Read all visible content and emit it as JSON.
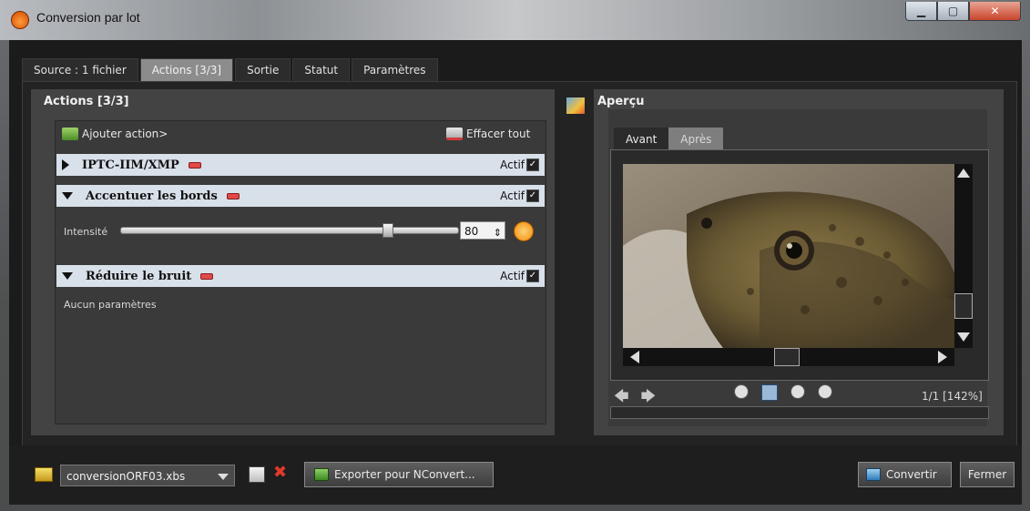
{
  "window": {
    "title": "Conversion par lot"
  },
  "tabs": [
    {
      "label": "Source : 1 fichier"
    },
    {
      "label": "Actions [3/3]"
    },
    {
      "label": "Sortie"
    },
    {
      "label": "Statut"
    },
    {
      "label": "Paramètres"
    }
  ],
  "actions_panel": {
    "title": "Actions [3/3]",
    "add_label": "Ajouter action>",
    "clear_label": "Effacer tout",
    "items": [
      {
        "name": "IPTC-IIM/XMP",
        "status": "Actif",
        "expanded": false
      },
      {
        "name": "Accentuer les bords",
        "status": "Actif",
        "expanded": true
      },
      {
        "name": "Réduire le bruit",
        "status": "Actif",
        "expanded": true
      }
    ],
    "intensity_label": "Intensité",
    "intensity_value": "80",
    "no_params_label": "Aucun paramètres"
  },
  "preview": {
    "title": "Aperçu",
    "tabs": [
      {
        "label": "Avant"
      },
      {
        "label": "Après"
      }
    ],
    "zoom_text": "1/1 [142%]"
  },
  "bottom": {
    "file_value": "conversionORF03.xbs",
    "export_label": "Exporter pour NConvert...",
    "convert_label": "Convertir",
    "close_label": "Fermer"
  },
  "colors": {
    "accent": "#d8e0ea",
    "close": "#c9452d"
  }
}
